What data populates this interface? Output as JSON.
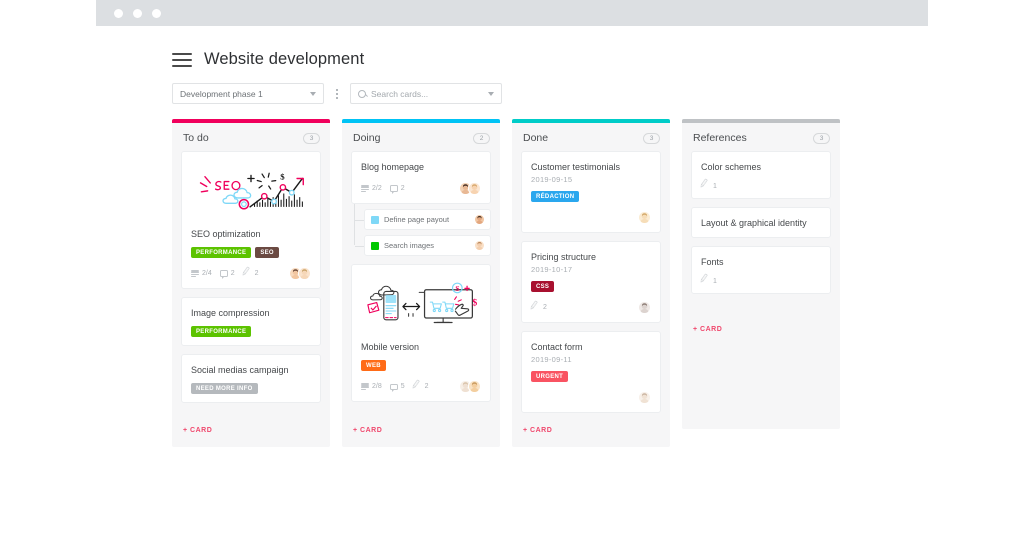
{
  "window": {
    "dots": [
      "close-dot",
      "minimize-dot",
      "maximize-dot"
    ]
  },
  "header": {
    "title": "Website development",
    "menu_icon": "hamburger-icon"
  },
  "toolbar": {
    "phase_select": {
      "value": "Development phase 1",
      "icon": "chevron-down-icon"
    },
    "more_icon": "kebab-menu-icon",
    "search": {
      "placeholder": "Search cards...",
      "value": "",
      "icon": "search-icon",
      "caret": "chevron-down-icon"
    }
  },
  "add_card_label": "+ CARD",
  "colors": {
    "todo_bar": "#f0005c",
    "doing_bar": "#00c3f5",
    "done_bar": "#00ccc8",
    "references_bar": "#bfc2c5",
    "accent_pink": "#f0486d",
    "tag_performance": "#5cc300",
    "tag_seo": "#6b4a42",
    "tag_need_more_info": "#b5b9bd",
    "tag_web": "#ff6b17",
    "tag_redaction": "#2aa7ee",
    "tag_css": "#a8102f",
    "tag_urgent": "#f95362"
  },
  "columns": [
    {
      "name": "To do",
      "count": "3",
      "bar_color": "#f0005c",
      "cards": [
        {
          "title": "SEO optimization",
          "date": "",
          "thumb": "seo-illustration",
          "tags": [
            {
              "label": "PERFORMANCE",
              "color": "#5cc300"
            },
            {
              "label": "SEO",
              "color": "#6b4a42"
            }
          ],
          "checklist": "2/4",
          "comments": "2",
          "attachments": "2",
          "avatars": [
            "avatar-1",
            "avatar-2"
          ]
        },
        {
          "title": "Image compression",
          "date": "",
          "thumb": "",
          "tags": [
            {
              "label": "PERFORMANCE",
              "color": "#5cc300"
            }
          ],
          "checklist": "",
          "comments": "",
          "attachments": "",
          "avatars": []
        },
        {
          "title": "Social medias campaign",
          "date": "",
          "thumb": "",
          "tags": [
            {
              "label": "NEED MORE INFO",
              "color": "#b5b9bd"
            }
          ],
          "checklist": "",
          "comments": "",
          "attachments": "",
          "avatars": []
        }
      ]
    },
    {
      "name": "Doing",
      "count": "2",
      "bar_color": "#00c3f5",
      "cards": [
        {
          "title": "Blog homepage",
          "date": "",
          "thumb": "",
          "tags": [],
          "checklist": "2/2",
          "comments": "2",
          "attachments": "",
          "avatars": [
            "avatar-3",
            "avatar-4"
          ],
          "subcards": [
            {
              "title": "Define page payout",
              "swatch": "#7fd8f7",
              "avatar": "avatar-5"
            },
            {
              "title": "Search images",
              "swatch": "#00c800",
              "avatar": "avatar-6"
            }
          ]
        },
        {
          "title": "Mobile version",
          "date": "",
          "thumb": "mobile-illustration",
          "tags": [
            {
              "label": "WEB",
              "color": "#ff6b17"
            }
          ],
          "checklist": "2/8",
          "comments": "5",
          "attachments": "2",
          "avatars": [
            "avatar-7",
            "avatar-8"
          ]
        }
      ]
    },
    {
      "name": "Done",
      "count": "3",
      "bar_color": "#00ccc8",
      "cards": [
        {
          "title": "Customer testimonials",
          "date": "2019-09-15",
          "thumb": "",
          "tags": [
            {
              "label": "RÉDACTION",
              "color": "#2aa7ee"
            }
          ],
          "checklist": "",
          "comments": "",
          "attachments": "",
          "avatars": [
            "avatar-9"
          ]
        },
        {
          "title": "Pricing structure",
          "date": "2019-10-17",
          "thumb": "",
          "tags": [
            {
              "label": "CSS",
              "color": "#a8102f"
            }
          ],
          "checklist": "",
          "comments": "",
          "attachments": "2",
          "avatars": [
            "avatar-10"
          ]
        },
        {
          "title": "Contact form",
          "date": "2019-09-11",
          "thumb": "",
          "tags": [
            {
              "label": "URGENT",
              "color": "#f95362"
            }
          ],
          "checklist": "",
          "comments": "",
          "attachments": "",
          "avatars": [
            "avatar-11"
          ]
        }
      ]
    },
    {
      "name": "References",
      "count": "3",
      "bar_color": "#bfc2c5",
      "cards": [
        {
          "title": "Color schemes",
          "date": "",
          "thumb": "",
          "tags": [],
          "checklist": "",
          "comments": "",
          "attachments": "1",
          "avatars": []
        },
        {
          "title": "Layout & graphical identity",
          "date": "",
          "thumb": "",
          "tags": [],
          "checklist": "",
          "comments": "",
          "attachments": "",
          "avatars": []
        },
        {
          "title": "Fonts",
          "date": "",
          "thumb": "",
          "tags": [],
          "checklist": "",
          "comments": "",
          "attachments": "1",
          "avatars": []
        }
      ]
    }
  ]
}
